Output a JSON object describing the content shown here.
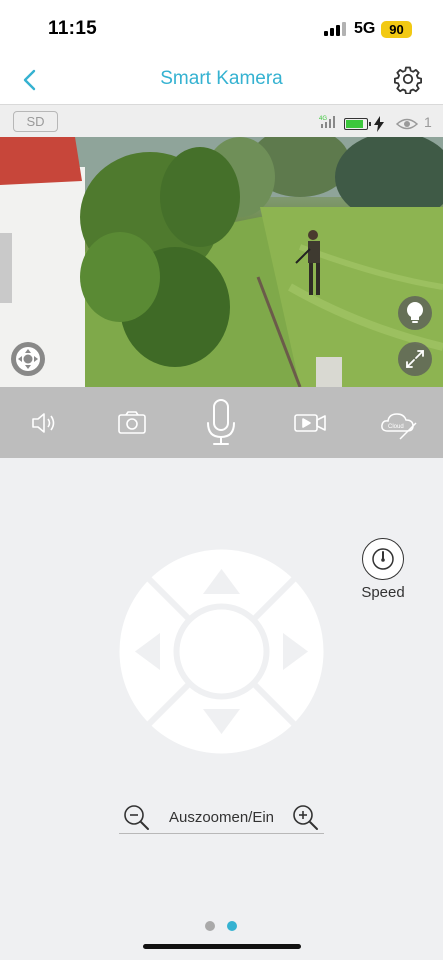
{
  "status_bar": {
    "time": "11:15",
    "network": "5G",
    "battery": "90",
    "colors": {
      "battery": "#f2c913"
    }
  },
  "nav": {
    "title": "Smart Kamera",
    "back_icon": "chevron-left-icon",
    "settings_icon": "gear-icon"
  },
  "info_bar": {
    "sd_label": "SD",
    "signal_label": "4G",
    "battery_level_fraction": 0.9,
    "charging": true,
    "viewer_count": "1"
  },
  "video_controls": {
    "pan_control_icon": "ptz-icon",
    "light_icon": "lightbulb-icon",
    "fullscreen_icon": "fullscreen-icon"
  },
  "toolbar": {
    "items": [
      {
        "name": "speaker",
        "icon": "speaker-icon"
      },
      {
        "name": "snapshot",
        "icon": "camera-icon"
      },
      {
        "name": "microphone",
        "icon": "microphone-icon"
      },
      {
        "name": "record",
        "icon": "video-record-icon"
      },
      {
        "name": "cloud",
        "icon": "cloud-off-icon",
        "label": "Cloud"
      }
    ]
  },
  "speed": {
    "label": "Speed",
    "icon": "speedometer-icon"
  },
  "ptz": {
    "directions": [
      "up",
      "down",
      "left",
      "right"
    ]
  },
  "zoom": {
    "label": "Auszoomen/Ein"
  },
  "pager": {
    "count": 2,
    "active_index": 1,
    "colors": {
      "active": "#35b2d1",
      "inactive": "#a9a9a9"
    }
  },
  "colors": {
    "accent": "#35b2d1",
    "toolbar": "#bdbdbd",
    "background": "#eff0f2"
  }
}
